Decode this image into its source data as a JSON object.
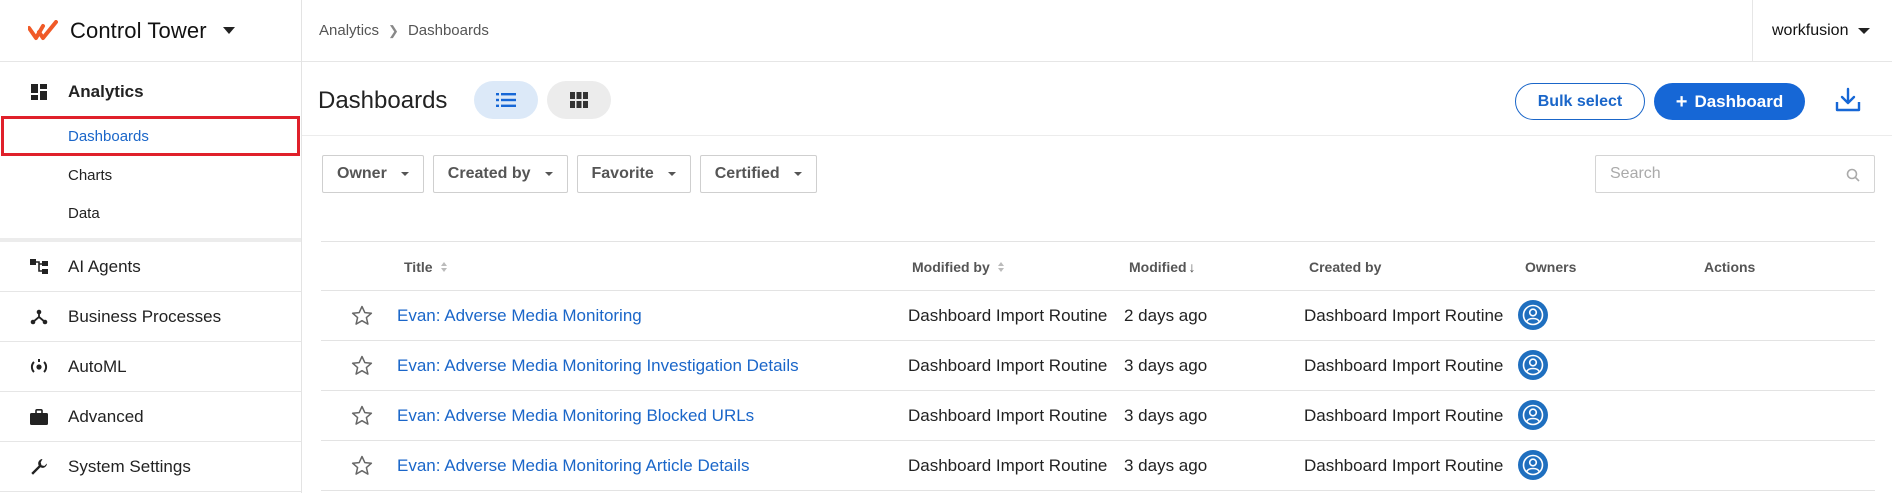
{
  "sidebar": {
    "brand": "Control Tower",
    "analytics_label": "Analytics",
    "sub_items": [
      "Dashboards",
      "Charts",
      "Data"
    ],
    "items": [
      "AI Agents",
      "Business Processes",
      "AutoML",
      "Advanced",
      "System Settings"
    ]
  },
  "topbar": {
    "breadcrumbs": [
      "Analytics",
      "Dashboards"
    ],
    "account": "workfusion"
  },
  "header": {
    "title": "Dashboards",
    "bulk_select": "Bulk select",
    "add_dashboard": "Dashboard"
  },
  "filters": [
    "Owner",
    "Created by",
    "Favorite",
    "Certified"
  ],
  "search": {
    "placeholder": "Search"
  },
  "table": {
    "columns": [
      "Title",
      "Modified by",
      "Modified",
      "Created by",
      "Owners",
      "Actions"
    ],
    "rows": [
      {
        "title": "Evan: Adverse Media Monitoring",
        "modified_by": "Dashboard Import Routine",
        "modified": "2 days ago",
        "created_by": "Dashboard Import Routine"
      },
      {
        "title": "Evan: Adverse Media Monitoring Investigation Details",
        "modified_by": "Dashboard Import Routine",
        "modified": "3 days ago",
        "created_by": "Dashboard Import Routine"
      },
      {
        "title": "Evan: Adverse Media Monitoring Blocked URLs",
        "modified_by": "Dashboard Import Routine",
        "modified": "3 days ago",
        "created_by": "Dashboard Import Routine"
      },
      {
        "title": "Evan: Adverse Media Monitoring Article Details",
        "modified_by": "Dashboard Import Routine",
        "modified": "3 days ago",
        "created_by": "Dashboard Import Routine"
      }
    ]
  },
  "colors": {
    "accent": "#1667d6",
    "link": "#1a66c9",
    "brand": "#f05a28",
    "highlight": "#e0202a"
  },
  "icons": [
    "workfusion-logo-icon",
    "dashboard-grid-icon",
    "ai-agents-icon",
    "business-process-icon",
    "automl-icon",
    "briefcase-icon",
    "wrench-icon",
    "list-view-icon",
    "grid-view-icon",
    "download-icon",
    "search-icon",
    "star-icon",
    "user-avatar-icon"
  ]
}
